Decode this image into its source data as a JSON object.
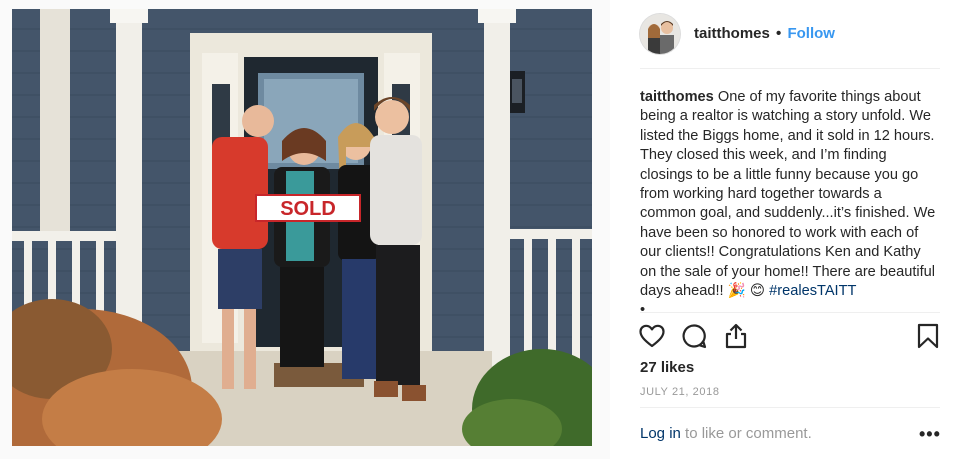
{
  "post": {
    "username": "taitthomes",
    "separator": "•",
    "follow_label": "Follow",
    "caption_text": "One of my favorite things about being a realtor is watching a story unfold. We listed the Biggs home, and it sold in 12 hours. They closed this week, and I’m finding closings to be a little funny because you go from working hard together towards a common goal, and suddenly...it’s finished. We have been so honored to work with each of our clients!! Congratulations Ken and Kathy on the sale of your home!! There are beautiful days ahead!! 🎉 😊 ",
    "hashtag": "#realesTAITT",
    "bullet": "•",
    "likes": "27 likes",
    "date": "JULY 21, 2018",
    "login_label": "Log in",
    "comment_prompt": " to like or comment.",
    "more_label": "•••"
  },
  "photo": {
    "sign_text": "SOLD"
  },
  "icons": [
    "heart-icon",
    "comment-icon",
    "share-icon",
    "bookmark-icon"
  ],
  "colors": {
    "follow": "#3897f0",
    "hashtag": "#003569",
    "muted": "#999999",
    "sign_red": "#c8262a"
  }
}
